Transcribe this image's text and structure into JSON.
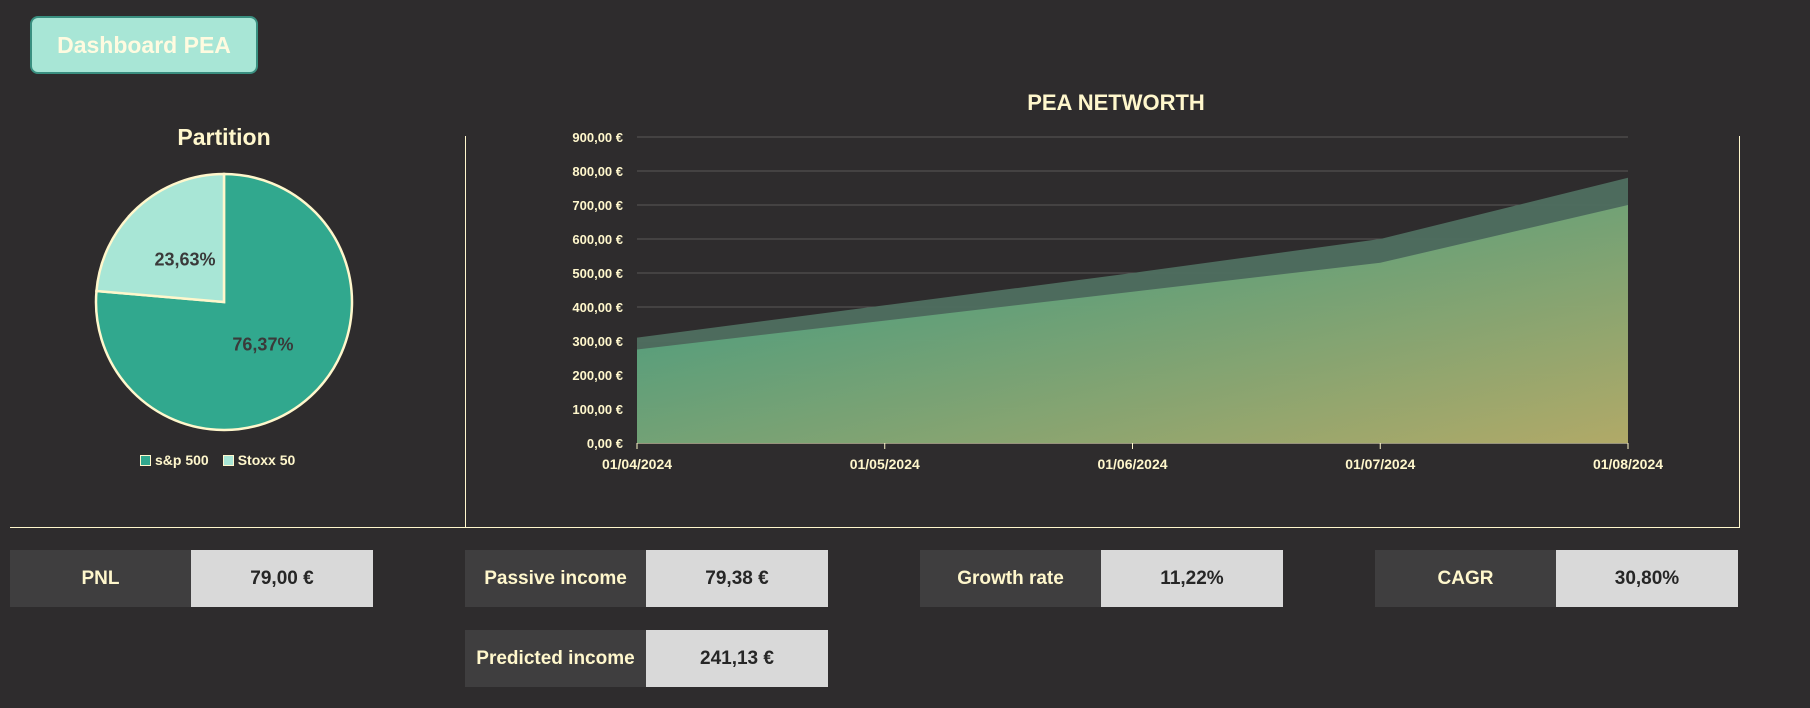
{
  "header": {
    "title": "Dashboard PEA"
  },
  "partition": {
    "title": "Partition",
    "legend": [
      {
        "label": "s&p 500",
        "color": "#31a88e"
      },
      {
        "label": "Stoxx 50",
        "color": "#a8e6d6"
      }
    ]
  },
  "networth": {
    "title": "PEA NETWORTH"
  },
  "kpis": {
    "pnl": {
      "label": "PNL",
      "value": "79,00 €"
    },
    "passive_income": {
      "label": "Passive income",
      "value": "79,38 €"
    },
    "growth_rate": {
      "label": "Growth rate",
      "value": "11,22%"
    },
    "cagr": {
      "label": "CAGR",
      "value": "30,80%"
    },
    "predicted_income": {
      "label": "Predicted income",
      "value": "241,13 €"
    }
  },
  "colors": {
    "background": "#2e2c2d",
    "accent_text": "#fff7cc",
    "pie_primary": "#31a88e",
    "pie_secondary": "#a8e6d6",
    "area_top": "#31a88e",
    "area_bottom": "#c8b86a",
    "area_back": "#4f6f60"
  },
  "chart_data": [
    {
      "type": "pie",
      "title": "Partition",
      "categories": [
        "s&p 500",
        "Stoxx 50"
      ],
      "values": [
        76.37,
        23.63
      ],
      "labels": [
        "76,37%",
        "23,63%"
      ],
      "legend": "bottom"
    },
    {
      "type": "area",
      "title": "PEA NETWORTH",
      "x": [
        "01/04/2024",
        "01/05/2024",
        "01/06/2024",
        "01/07/2024",
        "01/08/2024"
      ],
      "series": [
        {
          "values": [
            310,
            405,
            500,
            600,
            780
          ]
        },
        {
          "values": [
            275,
            360,
            445,
            530,
            700
          ]
        }
      ],
      "ylim": [
        0,
        900
      ],
      "yticks": [
        "0,00 €",
        "100,00 €",
        "200,00 €",
        "300,00 €",
        "400,00 €",
        "500,00 €",
        "600,00 €",
        "700,00 €",
        "800,00 €",
        "900,00 €"
      ],
      "grid": true
    }
  ]
}
